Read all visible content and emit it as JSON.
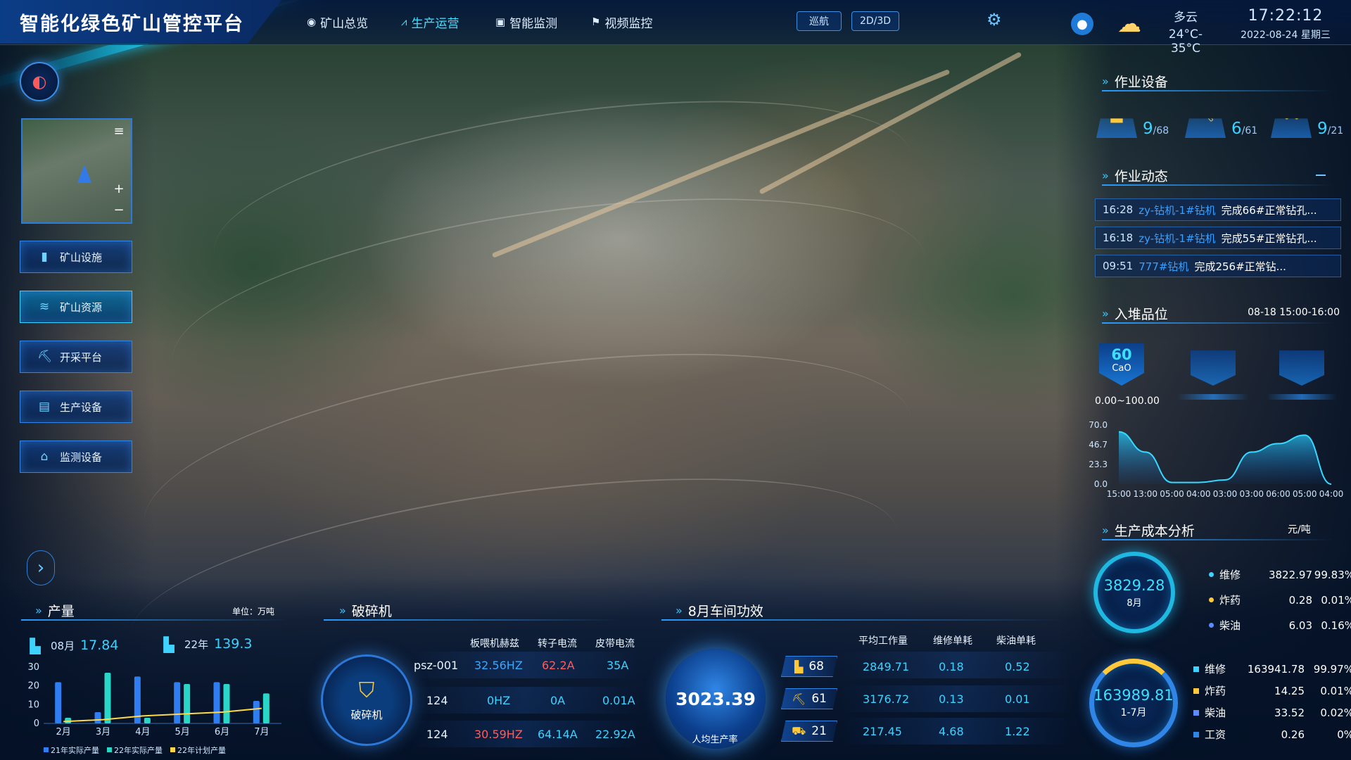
{
  "app": {
    "title": "智能化绿色矿山管控平台"
  },
  "nav": [
    {
      "label": "矿山总览",
      "icon": "globe-icon",
      "active": false
    },
    {
      "label": "生产运营",
      "icon": "chart-icon",
      "active": true
    },
    {
      "label": "智能监测",
      "icon": "monitor-icon",
      "active": false
    },
    {
      "label": "视频监控",
      "icon": "video-icon",
      "active": false
    }
  ],
  "header": {
    "cruise_label": "巡航",
    "view_toggle_label": "2D/3D",
    "weather": {
      "condition": "多云",
      "temp": "24°C-35°C"
    },
    "clock": {
      "time": "17:22:12",
      "date": "2022-08-24 星期三"
    }
  },
  "sidebar": {
    "items": [
      {
        "label": "矿山设施",
        "icon": "facility-icon",
        "active": false
      },
      {
        "label": "矿山资源",
        "icon": "layers-icon",
        "active": true
      },
      {
        "label": "开采平台",
        "icon": "excavator-icon",
        "active": false
      },
      {
        "label": "生产设备",
        "icon": "equipment-icon",
        "active": false
      },
      {
        "label": "监测设备",
        "icon": "sensor-icon",
        "active": false
      }
    ]
  },
  "equipment": {
    "title": "作业设备",
    "items": [
      {
        "icon": "dump-truck-icon",
        "active": "9",
        "total": "/68"
      },
      {
        "icon": "excavator-icon",
        "active": "6",
        "total": "/61"
      },
      {
        "icon": "loader-icon",
        "active": "9",
        "total": "/21"
      }
    ]
  },
  "activity": {
    "title": "作业动态",
    "items": [
      {
        "time": "16:28",
        "device": "zy-钻机-1#钻机",
        "message": "完成66#正常钻孔..."
      },
      {
        "time": "16:18",
        "device": "zy-钻机-1#钻机",
        "message": "完成55#正常钻孔..."
      },
      {
        "time": "09:51",
        "device": "777#钻机",
        "message": "完成256#正常钻..."
      }
    ]
  },
  "grade": {
    "title": "入堆品位",
    "time_range": "08-18 15:00-16:00",
    "badge_value": "60",
    "badge_name": "CaO",
    "range": "0.00~100.00",
    "chart_data": {
      "type": "area",
      "x": [
        "15:00",
        "13:00",
        "05:00",
        "04:00",
        "03:00",
        "03:00",
        "06:00",
        "05:00",
        "04:00"
      ],
      "y_ticks": [
        "70.0",
        "46.7",
        "23.3",
        "0.0"
      ],
      "values": [
        62,
        38,
        2,
        2,
        5,
        38,
        48,
        58,
        0
      ],
      "ylim": [
        0,
        70
      ]
    }
  },
  "cost": {
    "title": "生产成本分析",
    "unit": "元/吨",
    "month": {
      "value": "3829.28",
      "label": "8月",
      "rows": [
        {
          "name": "维修",
          "value": "3822.97",
          "pct": "99.83%",
          "color": "#3ed2ff"
        },
        {
          "name": "炸药",
          "value": "0.28",
          "pct": "0.01%",
          "color": "#ffc93a"
        },
        {
          "name": "柴油",
          "value": "6.03",
          "pct": "0.16%",
          "color": "#5b8cff"
        }
      ]
    },
    "ytd": {
      "value": "163989.81",
      "label": "1-7月",
      "rows": [
        {
          "name": "维修",
          "value": "163941.78",
          "pct": "99.97%",
          "color": "#3ed2ff"
        },
        {
          "name": "炸药",
          "value": "14.25",
          "pct": "0.01%",
          "color": "#ffc93a"
        },
        {
          "name": "柴油",
          "value": "33.52",
          "pct": "0.02%",
          "color": "#5b8cff"
        },
        {
          "name": "工资",
          "value": "0.26",
          "pct": "0%",
          "color": "#2f86e6"
        }
      ]
    }
  },
  "production": {
    "title": "产量",
    "unit": "单位：万吨",
    "month_label": "08月",
    "month_value": "17.84",
    "year_label": "22年",
    "year_value": "139.3",
    "chart_data": {
      "type": "bar",
      "categories": [
        "2月",
        "3月",
        "4月",
        "5月",
        "6月",
        "7月"
      ],
      "y_ticks": [
        "30",
        "20",
        "10",
        "0"
      ],
      "ylim": [
        0,
        30
      ],
      "series": [
        {
          "name": "21年实际产量",
          "color": "#2f7df0",
          "values": [
            22,
            6,
            25,
            22,
            22,
            12
          ]
        },
        {
          "name": "22年实际产量",
          "color": "#2ad6c8",
          "values": [
            3,
            27,
            3,
            21,
            21,
            16
          ]
        },
        {
          "name": "22年计划产量",
          "color": "#ffd84a",
          "values": [
            1,
            2,
            4,
            5,
            6,
            8
          ]
        }
      ]
    }
  },
  "crusher": {
    "title": "破碎机",
    "label": "破碎机",
    "headers": [
      "板喂机赫兹",
      "转子电流",
      "皮带电流"
    ],
    "rows": [
      {
        "name": "psz-001",
        "freq": "32.56HZ",
        "rotor": "62.2A",
        "belt": "35A"
      },
      {
        "name": "124",
        "freq": "0HZ",
        "rotor": "0A",
        "belt": "0.01A"
      },
      {
        "name": "124",
        "freq": "30.59HZ",
        "rotor": "64.14A",
        "belt": "22.92A"
      }
    ]
  },
  "efficiency": {
    "title": "8月车间功效",
    "center_value": "3023.39",
    "center_label": "人均生产率",
    "headers": [
      "平均工作量",
      "维修单耗",
      "柴油单耗"
    ],
    "rows": [
      {
        "icon": "dump-truck-icon",
        "count": "68",
        "work": "2849.71",
        "repair": "0.18",
        "diesel": "0.52"
      },
      {
        "icon": "excavator-icon",
        "count": "61",
        "work": "3176.72",
        "repair": "0.13",
        "diesel": "0.01"
      },
      {
        "icon": "loader-icon",
        "count": "21",
        "work": "217.45",
        "repair": "4.68",
        "diesel": "1.22"
      }
    ]
  }
}
